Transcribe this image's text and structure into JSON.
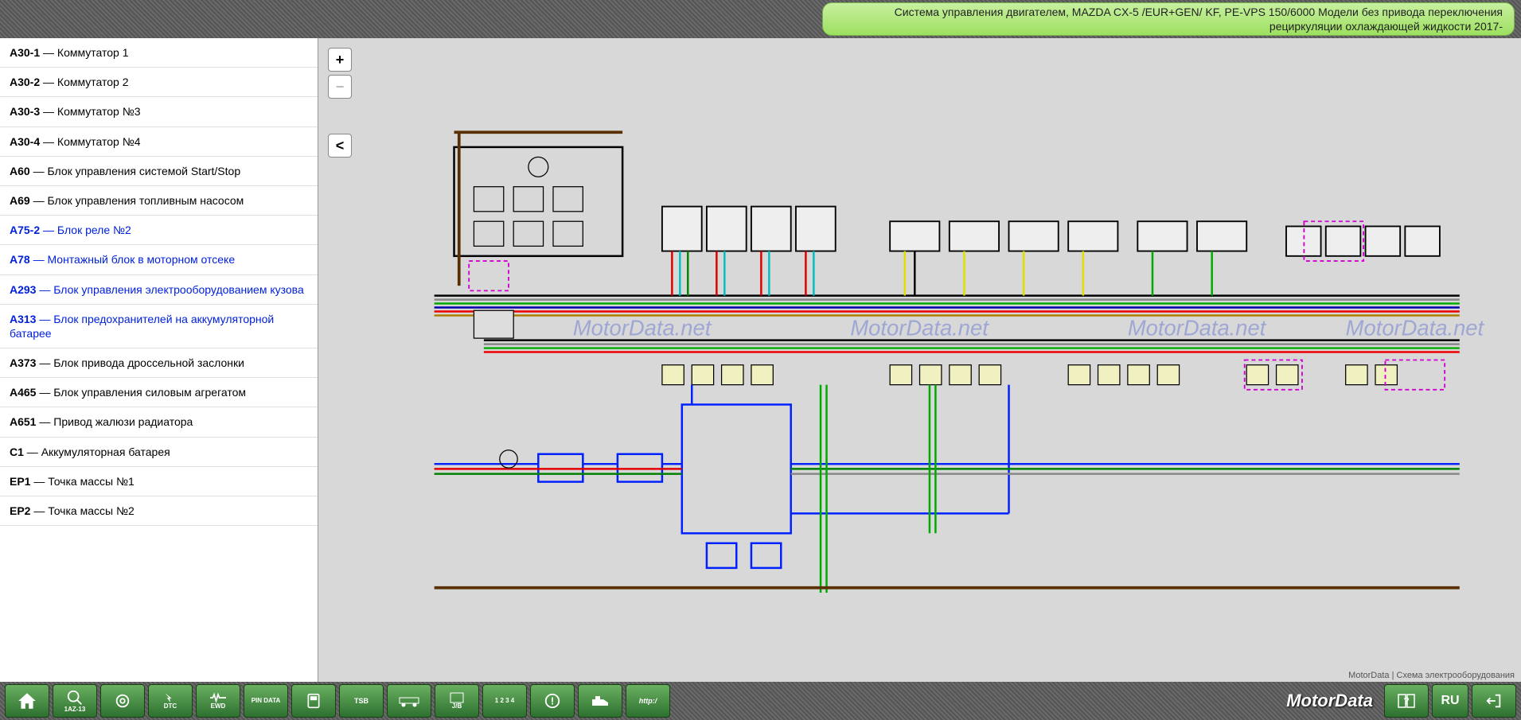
{
  "header": {
    "title": "Система управления двигателем, MAZDA CX-5 /EUR+GEN/ KF, PE-VPS 150/6000 Модели без привода переключения рециркуляции охлаждающей жидкости 2017-"
  },
  "sidebar": {
    "items": [
      {
        "code": "A30-1",
        "sep": " — ",
        "label": "Коммутатор 1",
        "color": "black"
      },
      {
        "code": "A30-2",
        "sep": " — ",
        "label": "Коммутатор 2",
        "color": "black"
      },
      {
        "code": "A30-3",
        "sep": " — ",
        "label": "Коммутатор №3",
        "color": "black"
      },
      {
        "code": "A30-4",
        "sep": " — ",
        "label": "Коммутатор №4",
        "color": "black"
      },
      {
        "code": "A60",
        "sep": " — ",
        "label": "Блок управления системой Start/Stop",
        "color": "black"
      },
      {
        "code": "A69",
        "sep": " — ",
        "label": "Блок управления топливным насосом",
        "color": "black"
      },
      {
        "code": "A75-2",
        "sep": " — ",
        "label": "Блок реле №2",
        "color": "blue"
      },
      {
        "code": "A78",
        "sep": " — ",
        "label": "Монтажный блок в моторном отсеке",
        "color": "blue"
      },
      {
        "code": "A293",
        "sep": " — ",
        "label": "Блок управления электрооборудованием кузова",
        "color": "blue"
      },
      {
        "code": "A313",
        "sep": " — ",
        "label": "Блок предохранителей на аккумуляторной батарее",
        "color": "blue"
      },
      {
        "code": "A373",
        "sep": " — ",
        "label": "Блок привода дроссельной заслонки",
        "color": "black"
      },
      {
        "code": "A465",
        "sep": " — ",
        "label": "Блок управления силовым агрегатом",
        "color": "black"
      },
      {
        "code": "A651",
        "sep": " — ",
        "label": "Привод жалюзи радиатора",
        "color": "black"
      },
      {
        "code": "C1",
        "sep": " — ",
        "label": "Аккумуляторная батарея",
        "color": "black"
      },
      {
        "code": "EP1",
        "sep": " — ",
        "label": "Точка массы №1",
        "color": "black"
      },
      {
        "code": "EP2",
        "sep": " — ",
        "label": "Точка массы №2",
        "color": "black"
      }
    ]
  },
  "zoom": {
    "in": "+",
    "out": "−",
    "collapse": "<"
  },
  "diagram": {
    "caption": "MotorData | Схема электрооборудования",
    "watermark": "MotorData.net"
  },
  "footer": {
    "brand": "MotorData",
    "lang": "RU",
    "buttons": [
      {
        "name": "home",
        "label": ""
      },
      {
        "name": "engine-id",
        "label": "1AZ-13"
      },
      {
        "name": "belt",
        "label": ""
      },
      {
        "name": "dtc",
        "label": "DTC"
      },
      {
        "name": "ewd",
        "label": "EWD"
      },
      {
        "name": "pin-data",
        "label": "PIN DATA"
      },
      {
        "name": "scan",
        "label": ""
      },
      {
        "name": "tsb",
        "label": "TSB"
      },
      {
        "name": "vehicle",
        "label": ""
      },
      {
        "name": "fuse-jb",
        "label": "J/B"
      },
      {
        "name": "fuse-num",
        "label": "1 2 3 4"
      },
      {
        "name": "warning",
        "label": ""
      },
      {
        "name": "oil",
        "label": ""
      },
      {
        "name": "http",
        "label": "http:/"
      }
    ]
  }
}
